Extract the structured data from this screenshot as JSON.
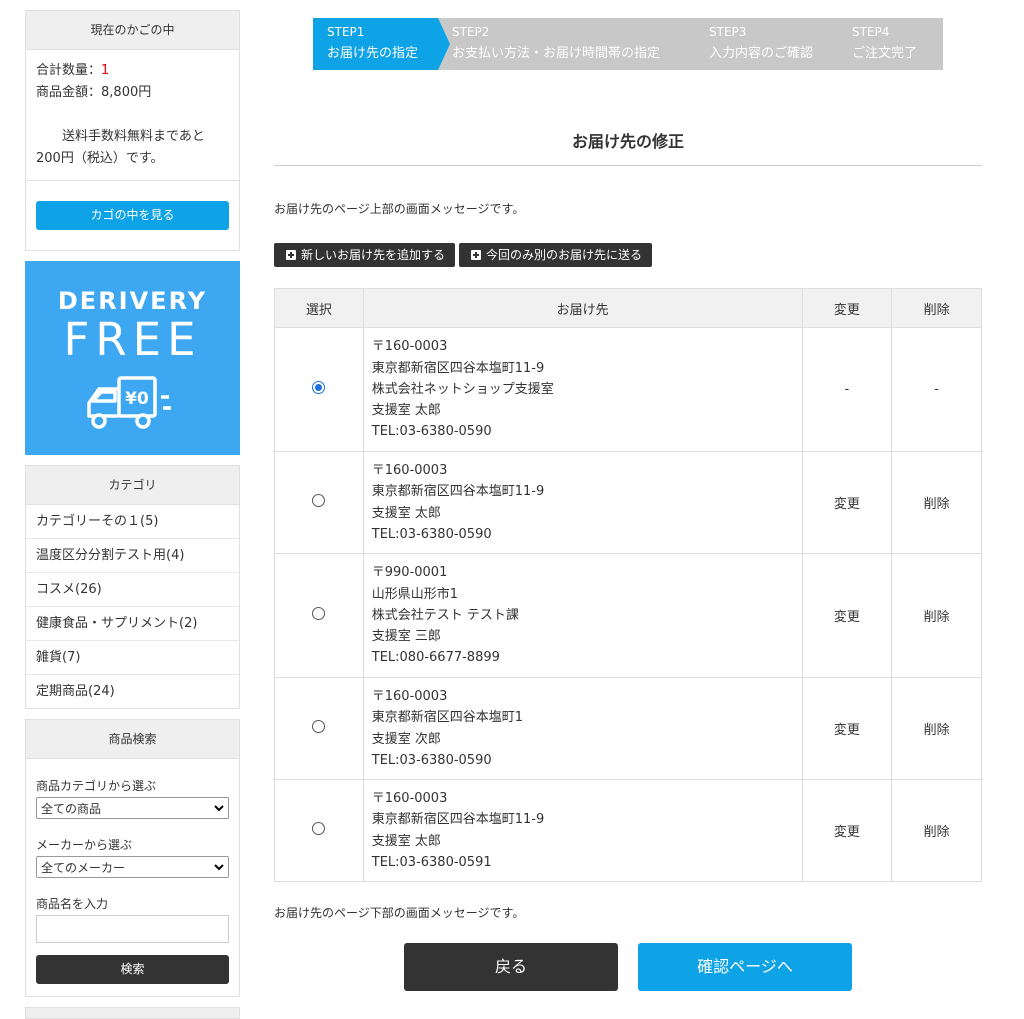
{
  "cart": {
    "title": "現在のかごの中",
    "qty_label": "合計数量：",
    "qty_value": "1",
    "amount_label": "商品金額：",
    "amount_value": "8,800円",
    "note": "送料手数料無料まであと200円（税込）です。",
    "view_button": "カゴの中を見る"
  },
  "banner": {
    "line1": "DERIVERY",
    "line2": "FREE",
    "price_tag": "¥0"
  },
  "category": {
    "title": "カテゴリ",
    "items": [
      "カテゴリーその１(5)",
      "温度区分分割テスト用(4)",
      "コスメ(26)",
      "健康食品・サプリメント(2)",
      "雑貨(7)",
      "定期商品(24)"
    ]
  },
  "search": {
    "title": "商品検索",
    "category_label": "商品カテゴリから選ぶ",
    "category_value": "全ての商品",
    "maker_label": "メーカーから選ぶ",
    "maker_value": "全てのメーカー",
    "name_label": "商品名を入力",
    "name_value": "",
    "button": "検索"
  },
  "steps": [
    {
      "num": "STEP1",
      "label": "お届け先の指定",
      "active": true
    },
    {
      "num": "STEP2",
      "label": "お支払い方法・お届け時間帯の指定",
      "active": false
    },
    {
      "num": "STEP3",
      "label": "入力内容のご確認",
      "active": false
    },
    {
      "num": "STEP4",
      "label": "ご注文完了",
      "active": false
    }
  ],
  "page": {
    "heading": "お届け先の修正",
    "message_top": "お届け先のページ上部の画面メッセージです。",
    "message_bottom": "お届け先のページ下部の画面メッセージです。",
    "add_button": "新しいお届け先を追加する",
    "once_button": "今回のみ別のお届け先に送る",
    "back_button": "戻る",
    "next_button": "確認ページへ"
  },
  "table": {
    "headers": {
      "select": "選択",
      "address": "お届け先",
      "change": "変更",
      "delete": "削除"
    },
    "rows": [
      {
        "selected": true,
        "lines": [
          "〒160-0003",
          "東京都新宿区四谷本塩町11-9",
          "株式会社ネットショップ支援室",
          "支援室 太郎",
          "TEL:03-6380-0590"
        ],
        "change": "-",
        "delete": "-"
      },
      {
        "selected": false,
        "lines": [
          "〒160-0003",
          "東京都新宿区四谷本塩町11-9",
          "支援室 太郎",
          "TEL:03-6380-0590"
        ],
        "change": "変更",
        "delete": "削除"
      },
      {
        "selected": false,
        "lines": [
          "〒990-0001",
          "山形県山形市1",
          "株式会社テスト テスト課",
          "支援室 三郎",
          "TEL:080-6677-8899"
        ],
        "change": "変更",
        "delete": "削除"
      },
      {
        "selected": false,
        "lines": [
          "〒160-0003",
          "東京都新宿区四谷本塩町1",
          "支援室 次郎",
          "TEL:03-6380-0590"
        ],
        "change": "変更",
        "delete": "削除"
      },
      {
        "selected": false,
        "lines": [
          "〒160-0003",
          "東京都新宿区四谷本塩町11-9",
          "支援室 太郎",
          "TEL:03-6380-0591"
        ],
        "change": "変更",
        "delete": "削除"
      }
    ]
  },
  "colors": {
    "accent": "#0ea2e6",
    "step_inactive": "#c8c8c8",
    "banner": "#3ea7f2",
    "dark": "#333333",
    "quantity_red": "#e60012"
  }
}
